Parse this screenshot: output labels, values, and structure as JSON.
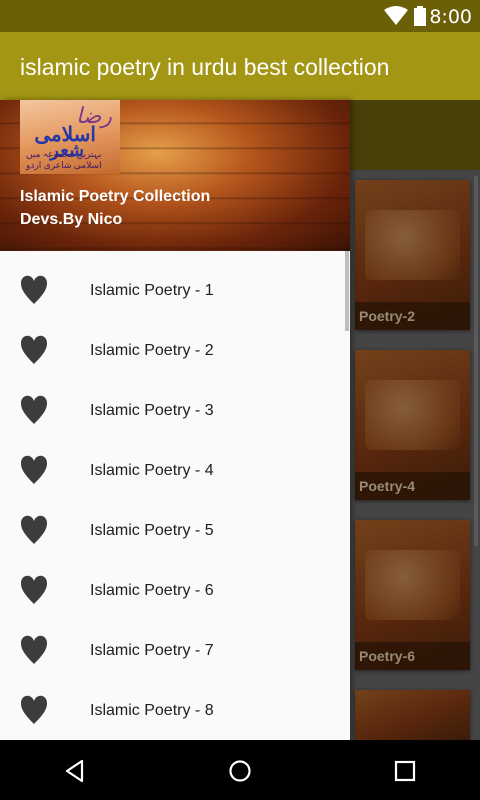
{
  "status_bar": {
    "time": "8:00"
  },
  "app_bar": {
    "title": "islamic poetry in urdu best collection"
  },
  "drawer": {
    "header": {
      "app_name": "Islamic Poetry Collection",
      "developer": "Devs.By Nico"
    },
    "items": [
      {
        "label": "Islamic Poetry - 1"
      },
      {
        "label": "Islamic Poetry - 2"
      },
      {
        "label": "Islamic Poetry - 3"
      },
      {
        "label": "Islamic Poetry - 4"
      },
      {
        "label": "Islamic Poetry - 5"
      },
      {
        "label": "Islamic Poetry - 6"
      },
      {
        "label": "Islamic Poetry - 7"
      },
      {
        "label": "Islamic Poetry - 8"
      }
    ]
  },
  "cards": [
    {
      "caption": "Poetry-2"
    },
    {
      "caption": "Poetry-4"
    },
    {
      "caption": "Poetry-6"
    }
  ],
  "colors": {
    "app_bar": "#a39614",
    "status_bar": "#6b5f08",
    "heart": "#3c3c3c"
  }
}
